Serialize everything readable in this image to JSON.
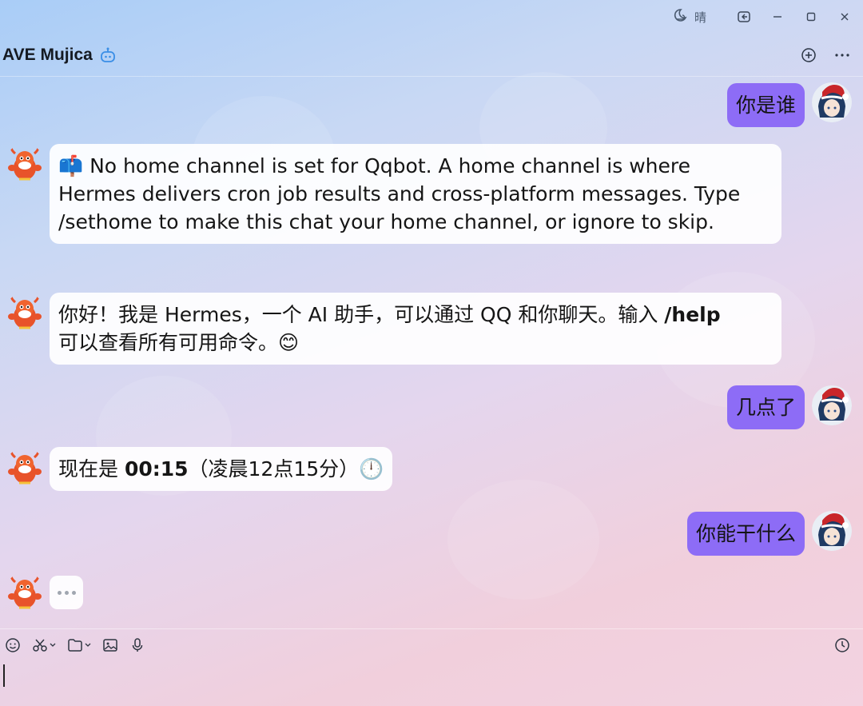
{
  "titlebar": {
    "weather_text": "晴",
    "weather_icon": "moon-cloud-icon",
    "buttons": [
      "pin-window-icon",
      "minimize-icon",
      "maximize-icon",
      "close-icon"
    ]
  },
  "header": {
    "title": "AVE Mujica",
    "badge_icon": "bot-icon",
    "actions": [
      "add-icon",
      "more-icon"
    ]
  },
  "messages": [
    {
      "side": "me",
      "text": "你是谁"
    },
    {
      "side": "bot",
      "emoji": "📫",
      "text": "No home channel is set for Qqbot. A home channel is where Hermes delivers cron job results and cross-platform messages. Type /sethome to make this chat your home channel, or ignore to skip."
    },
    {
      "side": "bot",
      "text_pre": "你好！我是 Hermes，一个 AI 助手，可以通过 QQ 和你聊天。输入 ",
      "text_bold": "/help",
      "text_post": "可以查看所有可用命令。",
      "emoji": "😊"
    },
    {
      "side": "me",
      "text": "几点了"
    },
    {
      "side": "bot",
      "text_pre": "现在是 ",
      "text_bold": "00:15",
      "text_post": "（凌晨12点15分）",
      "emoji": "🕛"
    },
    {
      "side": "me",
      "text": "你能干什么"
    }
  ],
  "typing_indicator": "…",
  "composer": {
    "tools": [
      "emoji-icon",
      "scissors-icon",
      "folder-icon",
      "image-icon",
      "microphone-icon"
    ],
    "history_icon": "clock-icon",
    "input_value": ""
  },
  "colors": {
    "my_bubble": "#8d6cf6",
    "bot_bubble": "#ffffff",
    "accent": "#3a8ee6"
  }
}
